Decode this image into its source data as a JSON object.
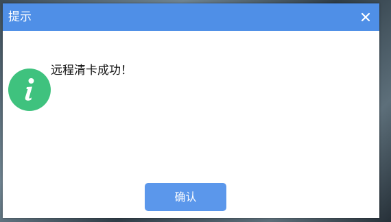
{
  "dialog": {
    "title": "提示",
    "close_icon": "close-icon",
    "info_icon": "info-icon",
    "message": "远程清卡成功！",
    "confirm_label": "确认"
  },
  "colors": {
    "titlebar": "#4f8fe7",
    "confirm_button": "#5b97eb",
    "info_icon": "#3fc27e"
  }
}
